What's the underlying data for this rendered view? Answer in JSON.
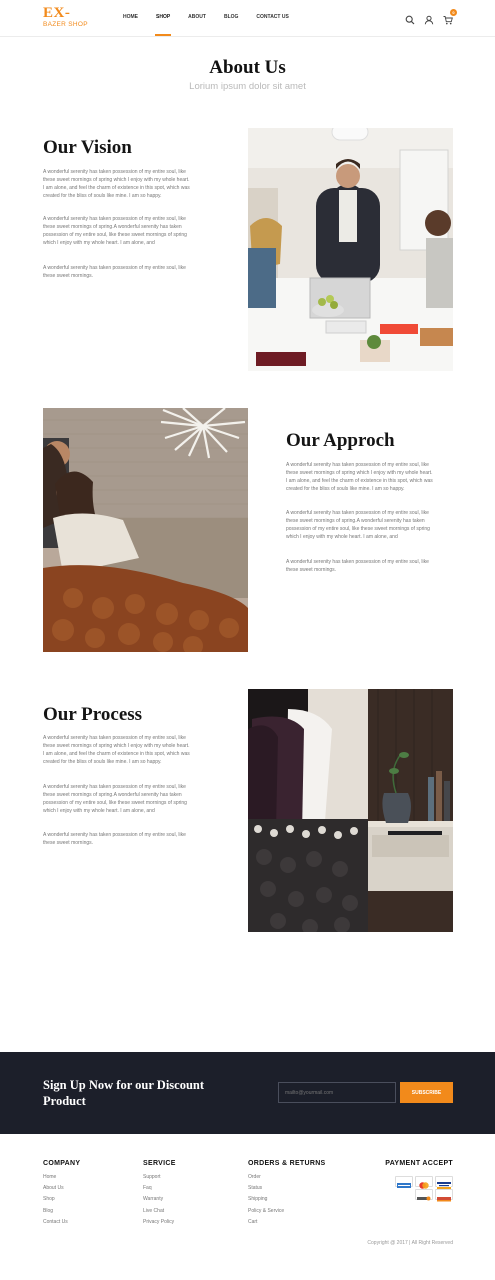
{
  "header": {
    "logo_top": "EX-",
    "logo_bottom": "BAZER SHOP",
    "nav": [
      "HOME",
      "SHOP",
      "ABOUT",
      "BLOG",
      "CONTACT US"
    ],
    "active_nav": "SHOP",
    "cart_count": "0",
    "icons": [
      "search-icon",
      "user-icon",
      "cart-icon"
    ]
  },
  "page": {
    "title": "About Us",
    "subtitle": "Lorium ipsum dolor sit amet"
  },
  "sections": {
    "vision": {
      "title": "Our Vision",
      "paragraphs": [
        "A wonderful serenity has taken possession of my entire soul, like these sweet mornings of spring which I enjoy with my whole heart. I am alone, and feel the charm of existence in this spot, which was created for the bliss of souls like mine. I am so happy.",
        "A wonderful serenity has taken possession of my entire soul, like these sweet mornings of spring.A wonderful serenity has taken possession of my entire soul, like these sweet mornings of spring which I enjoy with my whole heart. I am alone, and",
        "A wonderful serenity has taken possession of my entire soul, like these sweet mornings."
      ]
    },
    "approach": {
      "title": "Our Approch",
      "paragraphs": [
        "A wonderful serenity has taken possession of my entire soul, like these sweet mornings of spring which I enjoy with my whole heart. I am alone, and feel the charm of existence in this spot, which was created for the bliss of souls like mine. I am so happy.",
        "A wonderful serenity has taken possession of my entire soul, like these sweet mornings of spring.A wonderful serenity has taken possession of my entire soul, like these sweet mornings of spring which I enjoy with my whole heart. I am alone, and",
        "A wonderful serenity has taken possession of my entire soul, like these sweet mornings."
      ]
    },
    "process": {
      "title": "Our Process",
      "paragraphs": [
        "A wonderful serenity has taken possession of my entire soul, like these sweet mornings of spring which I enjoy with my whole heart. I am alone, and feel the charm of existence in this spot, which was created for the bliss of souls like mine. I am so happy.",
        "A wonderful serenity has taken possession of my entire soul, like these sweet mornings of spring.A wonderful serenity has taken possession of my entire soul, like these sweet mornings of spring which I enjoy with my whole heart. I am alone, and",
        "A wonderful serenity has taken possession of my entire soul, like these sweet mornings."
      ]
    }
  },
  "newsletter": {
    "title": "Sign Up Now for our Discount Product",
    "placeholder": "mailto@yourmail.com",
    "button": "SUBSCRIBE"
  },
  "footer": {
    "company": {
      "heading": "COMPANY",
      "links": [
        "Home",
        "About Us",
        "Shop",
        "Blog",
        "Contact Us"
      ]
    },
    "service": {
      "heading": "SERVICE",
      "links": [
        "Support",
        "Faq",
        "Warranty",
        "Live Chat",
        "Privacy Policy"
      ]
    },
    "orders": {
      "heading": "ORDERS & RETURNS",
      "links": [
        "Order",
        "Status",
        "Shipping",
        "Policy & Service",
        "Cart"
      ]
    },
    "payment": {
      "heading": "PAYMENT ACCEPT",
      "cards": [
        "american-express-card-icon",
        "mastercard-icon",
        "visa-card-icon",
        "discover-card-icon",
        "maestro-card-icon"
      ]
    },
    "copyright": "Copyright @ 2017 | All Right Reserved"
  },
  "colors": {
    "accent": "#f28a1b",
    "dark_band": "#1c1f2a",
    "muted_text": "#777777"
  }
}
